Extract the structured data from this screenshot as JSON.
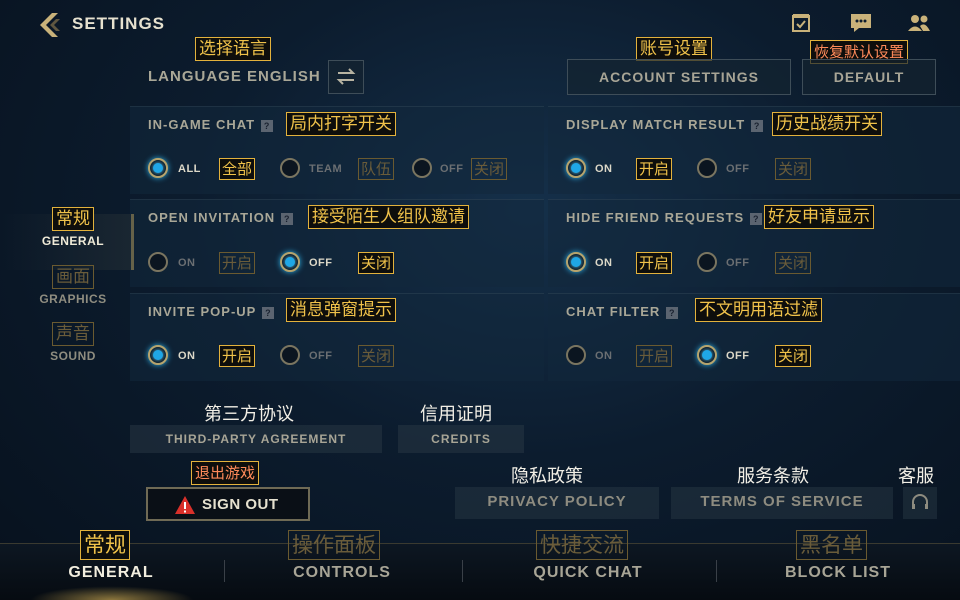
{
  "header": {
    "title": "SETTINGS"
  },
  "top": {
    "language": {
      "cn": "选择语言",
      "label": "LANGUAGE ENGLISH"
    },
    "account": {
      "cn": "账号设置",
      "label": "ACCOUNT SETTINGS"
    },
    "default": {
      "cn": "恢复默认设置",
      "label": "DEFAULT"
    }
  },
  "sidebar": {
    "items": [
      {
        "cn": "常规",
        "label": "GENERAL",
        "active": true
      },
      {
        "cn": "画面",
        "label": "GRAPHICS",
        "active": false
      },
      {
        "cn": "声音",
        "label": "SOUND",
        "active": false
      }
    ]
  },
  "options": {
    "in_game_chat": {
      "label": "IN-GAME CHAT",
      "cn": "局内打字开关",
      "choices": [
        {
          "label": "ALL",
          "cn": "全部"
        },
        {
          "label": "TEAM",
          "cn": "队伍"
        },
        {
          "label": "OFF",
          "cn": "关闭"
        }
      ],
      "selected": "ALL"
    },
    "display_match_result": {
      "label": "DISPLAY MATCH RESULT",
      "cn": "历史战绩开关",
      "choices": [
        {
          "label": "ON",
          "cn": "开启"
        },
        {
          "label": "OFF",
          "cn": "关闭"
        }
      ],
      "selected": "ON"
    },
    "open_invitation": {
      "label": "OPEN INVITATION",
      "cn": "接受陌生人组队邀请",
      "choices": [
        {
          "label": "ON",
          "cn": "开启"
        },
        {
          "label": "OFF",
          "cn": "关闭"
        }
      ],
      "selected": "OFF"
    },
    "hide_friend_requests": {
      "label": "HIDE FRIEND REQUESTS",
      "cn": "好友申请显示",
      "choices": [
        {
          "label": "ON",
          "cn": "开启"
        },
        {
          "label": "OFF",
          "cn": "关闭"
        }
      ],
      "selected": "ON"
    },
    "invite_popup": {
      "label": "INVITE POP-UP",
      "cn": "消息弹窗提示",
      "choices": [
        {
          "label": "ON",
          "cn": "开启"
        },
        {
          "label": "OFF",
          "cn": "关闭"
        }
      ],
      "selected": "ON"
    },
    "chat_filter": {
      "label": "CHAT FILTER",
      "cn": "不文明用语过滤",
      "choices": [
        {
          "label": "ON",
          "cn": "开启"
        },
        {
          "label": "OFF",
          "cn": "关闭"
        }
      ],
      "selected": "OFF"
    }
  },
  "links": {
    "third_party": {
      "cn": "第三方协议",
      "label": "THIRD-PARTY AGREEMENT"
    },
    "credits": {
      "cn": "信用证明",
      "label": "CREDITS"
    },
    "sign_out": {
      "cn": "退出游戏",
      "label": "SIGN OUT"
    },
    "privacy": {
      "cn": "隐私政策",
      "label": "PRIVACY POLICY"
    },
    "terms": {
      "cn": "服务条款",
      "label": "TERMS OF SERVICE"
    },
    "support": {
      "cn": "客服"
    }
  },
  "bottom_tabs": [
    {
      "cn": "常规",
      "label": "GENERAL",
      "active": true
    },
    {
      "cn": "操作面板",
      "label": "CONTROLS",
      "active": false
    },
    {
      "cn": "快捷交流",
      "label": "QUICK CHAT",
      "active": false
    },
    {
      "cn": "黑名单",
      "label": "BLOCK LIST",
      "active": false
    }
  ],
  "icons": {
    "back": "chevron-left-icon",
    "tasks": "checklist-icon",
    "chat": "chat-bubble-icon",
    "friends": "friends-icon",
    "swap": "swap-icon",
    "help": "question-icon",
    "warning": "warning-icon",
    "headset": "headset-icon"
  },
  "colors": {
    "accent_gold": "#e3b23c",
    "radio_on": "#1fa7e6",
    "sign_out_red": "#d9302a",
    "annotation_red": "#ff8a5a"
  }
}
